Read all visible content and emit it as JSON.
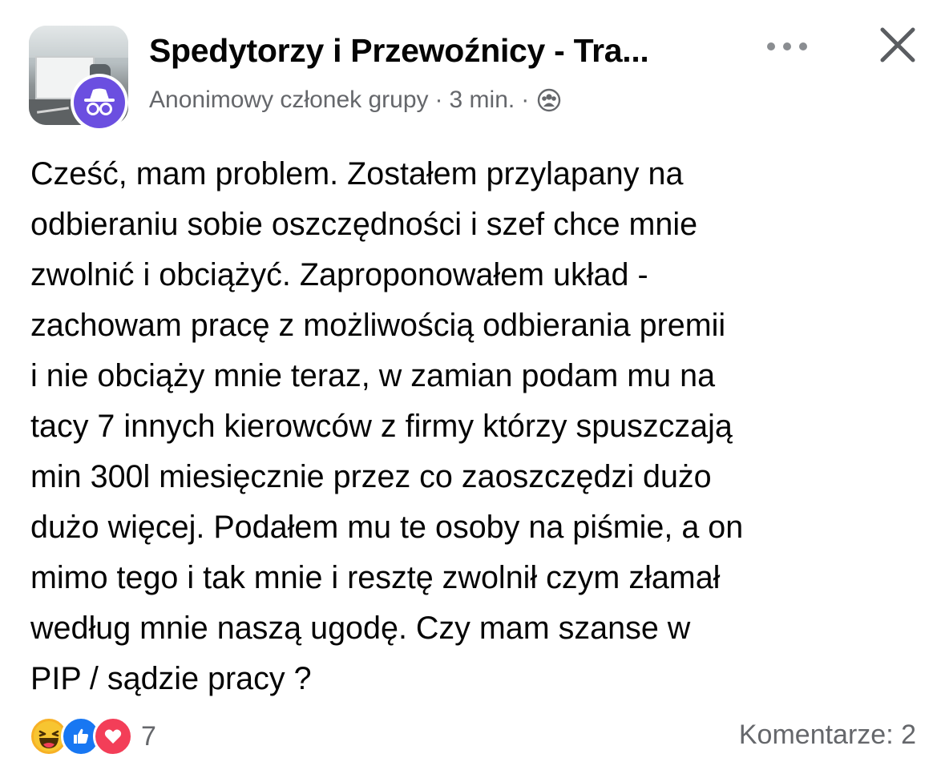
{
  "header": {
    "group_name": "Spedytorzy i Przewoźnicy - Tra...",
    "author": "Anonimowy członek grupy",
    "separator": "·",
    "time": "3 min.",
    "audience_icon": "group-icon",
    "more_icon": "more-horizontal-icon",
    "close_icon": "close-icon"
  },
  "post": {
    "lines": [
      "Cześć, mam problem. Zostałem przylapany na",
      "odbieraniu sobie oszczędności i szef chce mnie",
      "zwolnić i obciążyć. Zaproponowałem układ -",
      "zachowam pracę z możliwością odbierania premii",
      "i nie obciąży mnie teraz, w zamian podam mu na",
      "tacy 7 innych kierowców z firmy którzy spuszczają",
      "min 300l miesięcznie przez co zaoszczędzi dużo",
      "dużo więcej. Podałem mu te osoby na piśmie, a on",
      "mimo tego i tak mnie i resztę zwolnił czym złamał",
      "według mnie naszą ugodę. Czy mam szanse w",
      "PIP / sądzie pracy ?"
    ]
  },
  "footer": {
    "reactions": [
      "haha-reaction-icon",
      "like-reaction-icon",
      "love-reaction-icon"
    ],
    "reaction_count": "7",
    "comments": "Komentarze: 2"
  },
  "colors": {
    "anon_avatar": "#6b4fe0",
    "like": "#1877f2",
    "love": "#f33e58",
    "haha": "#f7b125",
    "secondary_text": "#65676b"
  }
}
